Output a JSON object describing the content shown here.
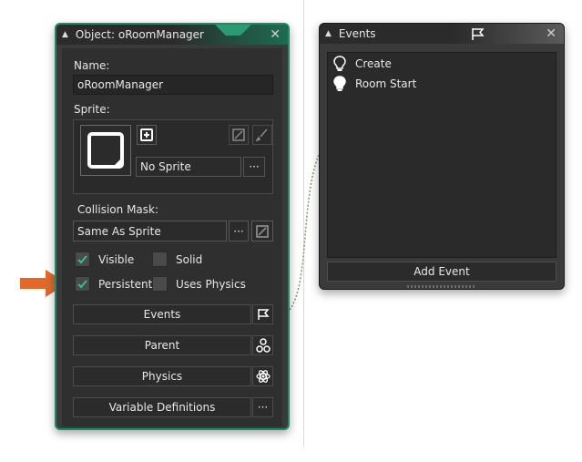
{
  "object_window": {
    "title": "Object: oRoomManager",
    "name_label": "Name:",
    "name_value": "oRoomManager",
    "sprite_label": "Sprite:",
    "sprite_value": "No Sprite",
    "sprite_menu_label": "···",
    "collision_label": "Collision Mask:",
    "collision_value": "Same As Sprite",
    "collision_menu_label": "···",
    "checkboxes": {
      "visible": {
        "label": "Visible",
        "checked": true
      },
      "solid": {
        "label": "Solid",
        "checked": false
      },
      "persistent": {
        "label": "Persistent",
        "checked": true
      },
      "uses_physics": {
        "label": "Uses Physics",
        "checked": false
      }
    },
    "buttons": {
      "events": "Events",
      "parent": "Parent",
      "physics": "Physics",
      "variable_definitions": "Variable Definitions",
      "variable_menu_label": "···"
    }
  },
  "events_window": {
    "title": "Events",
    "items": [
      {
        "label": "Create",
        "icon": "lightbulb-outline-icon"
      },
      {
        "label": "Room Start",
        "icon": "lightbulb-filled-icon"
      }
    ],
    "add_event_label": "Add Event"
  },
  "colors": {
    "accent": "#1d8c66",
    "arrow": "#e06a2c",
    "check": "#35c08a"
  }
}
